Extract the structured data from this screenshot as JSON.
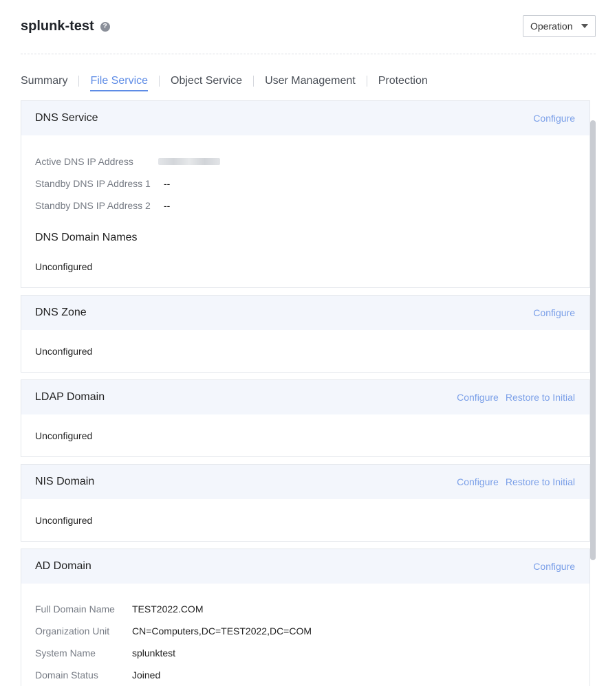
{
  "header": {
    "title": "splunk-test",
    "operation_label": "Operation"
  },
  "tabs": [
    {
      "label": "Summary"
    },
    {
      "label": "File Service"
    },
    {
      "label": "Object Service"
    },
    {
      "label": "User Management"
    },
    {
      "label": "Protection"
    }
  ],
  "dns_service": {
    "title": "DNS Service",
    "configure": "Configure",
    "active_label": "Active DNS IP Address",
    "standby1_label": "Standby DNS IP Address 1",
    "standby1_value": "--",
    "standby2_label": "Standby DNS IP Address 2",
    "standby2_value": "--",
    "domain_names_title": "DNS Domain Names",
    "domain_names_value": "Unconfigured"
  },
  "dns_zone": {
    "title": "DNS Zone",
    "configure": "Configure",
    "status": "Unconfigured"
  },
  "ldap_domain": {
    "title": "LDAP Domain",
    "configure": "Configure",
    "restore": "Restore to Initial",
    "status": "Unconfigured"
  },
  "nis_domain": {
    "title": "NIS Domain",
    "configure": "Configure",
    "restore": "Restore to Initial",
    "status": "Unconfigured"
  },
  "ad_domain": {
    "title": "AD Domain",
    "configure": "Configure",
    "fields": [
      {
        "label": "Full Domain Name",
        "value": "TEST2022.COM"
      },
      {
        "label": "Organization Unit",
        "value": "CN=Computers,DC=TEST2022,DC=COM"
      },
      {
        "label": "System Name",
        "value": "splunktest"
      },
      {
        "label": "Domain Status",
        "value": "Joined"
      }
    ]
  },
  "colors": {
    "accent": "#5e8ce6",
    "link": "#7a9fe8",
    "panel_header_bg": "#f3f6fc"
  }
}
